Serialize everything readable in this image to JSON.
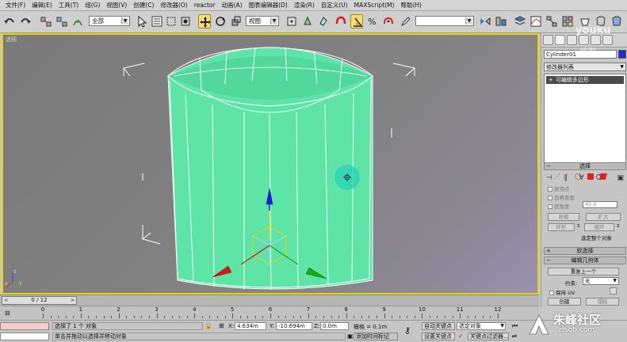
{
  "menu": [
    "文件(F)",
    "编辑(E)",
    "工具(T)",
    "组(G)",
    "视图(V)",
    "创建(C)",
    "修改器(O)",
    "reactor",
    "动画(A)",
    "图表编辑器(D)",
    "渲染(R)",
    "自定义(U)",
    "MAXScript(M)",
    "帮助(H)"
  ],
  "toolbar": {
    "selection_filter": "全部",
    "reference_coord": "视图",
    "named_selection": ""
  },
  "viewport": {
    "label": "透视",
    "object_color": "#5fe4a8",
    "active_border_color": "#e7d400"
  },
  "command_panel": {
    "object_name": "Cylinder01",
    "object_color": "#1f2bd8",
    "modifier_list_label": "修改器列表",
    "stack_item": "可编辑多边形",
    "selection_rollout": {
      "title": "选择",
      "by_vertex": "按顶点",
      "ignore_backfacing": "忽略背面",
      "by_angle": "按角度:",
      "angle_value": "45.0",
      "shrink": "收缩",
      "grow": "扩大",
      "ring": "环形",
      "loop": "循环",
      "status": "选定整个对象"
    },
    "soft_selection_title": "软选择",
    "edit_geometry": {
      "title": "编辑几何体",
      "repeat_last": "重复上一个",
      "constraint_label": "约束:",
      "constraint_value": "无",
      "preserve_uv": "保持 UV",
      "create": "创建",
      "collapse": "塌陷"
    }
  },
  "timeline": {
    "frame_display": "0 / 12",
    "prev_arrow": "<",
    "next_arrow": ">",
    "ticks": [
      "0",
      "1",
      "2",
      "3",
      "4",
      "5",
      "6",
      "7",
      "8",
      "9",
      "10",
      "11",
      "12"
    ]
  },
  "status": {
    "selected_text": "选择了 1 个 对象",
    "prompt_text": "单击并拖动以选择并移动对象",
    "x_label": "X:",
    "x_value": "4.634m",
    "y_label": "Y:",
    "y_value": "-10.694m",
    "z_label": "Z:",
    "z_value": "0.0m",
    "grid_label": "栅格 = 0.1m",
    "auto_key": "自动关键点",
    "selected_object_dropdown": "选定对象",
    "set_key": "设置关键点",
    "key_filters": "关键点过滤器...",
    "add_time_tag": "添加时间标记"
  },
  "watermarks": {
    "youku": "youku",
    "youku_sub": "优酷",
    "zhufeng": "朱峰社区",
    "zhufeng_url": "zfsqb.com"
  }
}
